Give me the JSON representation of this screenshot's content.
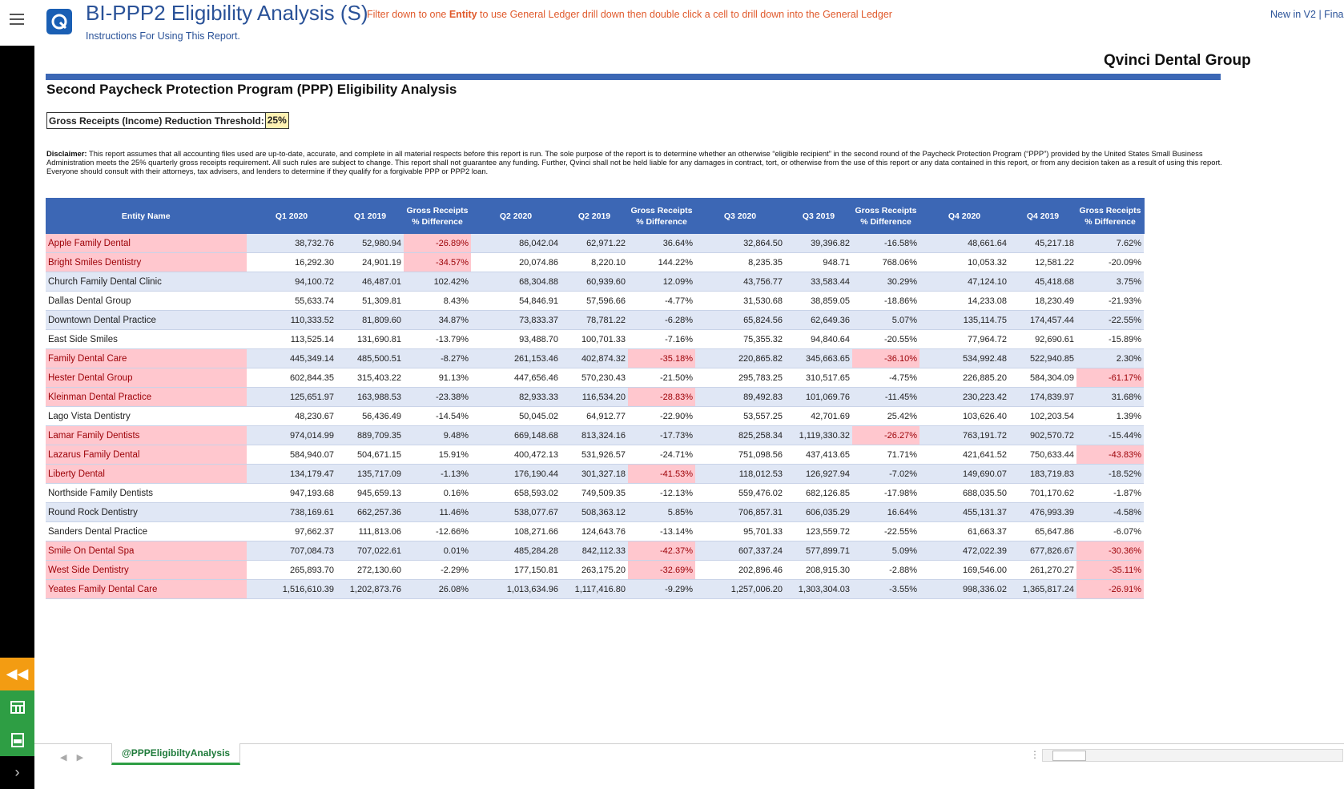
{
  "header": {
    "app_title": "BI-PPP2 Eligibility Analysis (S)",
    "filter_note_prefix": "Filter down to one ",
    "filter_note_bold": "Entity",
    "filter_note_suffix": " to use General Ledger drill down then double click a cell to drill down into the General Ledger",
    "instructions_link": "Instructions For Using This Report.",
    "new_in": "New in V2 | Fina"
  },
  "report": {
    "company": "Qvinci Dental Group",
    "title": "Second Paycheck Protection Program (PPP) Eligibility Analysis",
    "threshold_label": "Gross Receipts (Income) Reduction Threshold:",
    "threshold_value": "25%",
    "disclaimer_label": "Disclaimer:",
    "disclaimer_text": " This report assumes that all accounting files used are up-to-date, accurate, and complete in all material respects before this report is run.  The sole purpose of the report is to determine whether an otherwise “eligible recipient” in the second round of the Paycheck Protection Program (“PPP”) provided by the United States Small Business Administration meets the 25% quarterly gross receipts requirement.  All such rules are subject to change.  This report shall not guarantee any funding.  Further, Qvinci shall not be held liable for any damages in contract, tort, or otherwise from the use of this report or any data contained in this report, or from any decision taken as a result of using this report. Everyone should consult with their attorneys, tax advisers, and lenders to determine if they qualify for a forgivable PPP or PPP2 loan."
  },
  "table": {
    "columns": [
      "Entity Name",
      "Q1 2020",
      "Q1 2019",
      "Gross Receipts % Difference",
      "Q2 2020",
      "Q2 2019",
      "Gross Receipts % Difference",
      "Q3 2020",
      "Q3 2019",
      "Gross Receipts % Difference",
      "Q4 2020",
      "Q4 2019",
      "Gross Receipts % Difference"
    ],
    "rows": [
      [
        "Apple Family Dental",
        "38,732.76",
        "52,980.94",
        "-26.89%",
        "86,042.04",
        "62,971.22",
        "36.64%",
        "32,864.50",
        "39,396.82",
        "-16.58%",
        "48,661.64",
        "45,217.18",
        "7.62%"
      ],
      [
        "Bright Smiles Dentistry",
        "16,292.30",
        "24,901.19",
        "-34.57%",
        "20,074.86",
        "8,220.10",
        "144.22%",
        "8,235.35",
        "948.71",
        "768.06%",
        "10,053.32",
        "12,581.22",
        "-20.09%"
      ],
      [
        "Church Family Dental Clinic",
        "94,100.72",
        "46,487.01",
        "102.42%",
        "68,304.88",
        "60,939.60",
        "12.09%",
        "43,756.77",
        "33,583.44",
        "30.29%",
        "47,124.10",
        "45,418.68",
        "3.75%"
      ],
      [
        "Dallas Dental Group",
        "55,633.74",
        "51,309.81",
        "8.43%",
        "54,846.91",
        "57,596.66",
        "-4.77%",
        "31,530.68",
        "38,859.05",
        "-18.86%",
        "14,233.08",
        "18,230.49",
        "-21.93%"
      ],
      [
        "Downtown Dental Practice",
        "110,333.52",
        "81,809.60",
        "34.87%",
        "73,833.37",
        "78,781.22",
        "-6.28%",
        "65,824.56",
        "62,649.36",
        "5.07%",
        "135,114.75",
        "174,457.44",
        "-22.55%"
      ],
      [
        "East Side Smiles",
        "113,525.14",
        "131,690.81",
        "-13.79%",
        "93,488.70",
        "100,701.33",
        "-7.16%",
        "75,355.32",
        "94,840.64",
        "-20.55%",
        "77,964.72",
        "92,690.61",
        "-15.89%"
      ],
      [
        "Family Dental Care",
        "445,349.14",
        "485,500.51",
        "-8.27%",
        "261,153.46",
        "402,874.32",
        "-35.18%",
        "220,865.82",
        "345,663.65",
        "-36.10%",
        "534,992.48",
        "522,940.85",
        "2.30%"
      ],
      [
        "Hester Dental Group",
        "602,844.35",
        "315,403.22",
        "91.13%",
        "447,656.46",
        "570,230.43",
        "-21.50%",
        "295,783.25",
        "310,517.65",
        "-4.75%",
        "226,885.20",
        "584,304.09",
        "-61.17%"
      ],
      [
        "Kleinman Dental Practice",
        "125,651.97",
        "163,988.53",
        "-23.38%",
        "82,933.33",
        "116,534.20",
        "-28.83%",
        "89,492.83",
        "101,069.76",
        "-11.45%",
        "230,223.42",
        "174,839.97",
        "31.68%"
      ],
      [
        "Lago Vista Dentistry",
        "48,230.67",
        "56,436.49",
        "-14.54%",
        "50,045.02",
        "64,912.77",
        "-22.90%",
        "53,557.25",
        "42,701.69",
        "25.42%",
        "103,626.40",
        "102,203.54",
        "1.39%"
      ],
      [
        "Lamar Family Dentists",
        "974,014.99",
        "889,709.35",
        "9.48%",
        "669,148.68",
        "813,324.16",
        "-17.73%",
        "825,258.34",
        "1,119,330.32",
        "-26.27%",
        "763,191.72",
        "902,570.72",
        "-15.44%"
      ],
      [
        "Lazarus Family Dental",
        "584,940.07",
        "504,671.15",
        "15.91%",
        "400,472.13",
        "531,926.57",
        "-24.71%",
        "751,098.56",
        "437,413.65",
        "71.71%",
        "421,641.52",
        "750,633.44",
        "-43.83%"
      ],
      [
        "Liberty Dental",
        "134,179.47",
        "135,717.09",
        "-1.13%",
        "176,190.44",
        "301,327.18",
        "-41.53%",
        "118,012.53",
        "126,927.94",
        "-7.02%",
        "149,690.07",
        "183,719.83",
        "-18.52%"
      ],
      [
        "Northside Family Dentists",
        "947,193.68",
        "945,659.13",
        "0.16%",
        "658,593.02",
        "749,509.35",
        "-12.13%",
        "559,476.02",
        "682,126.85",
        "-17.98%",
        "688,035.50",
        "701,170.62",
        "-1.87%"
      ],
      [
        "Round Rock Dentistry",
        "738,169.61",
        "662,257.36",
        "11.46%",
        "538,077.67",
        "508,363.12",
        "5.85%",
        "706,857.31",
        "606,035.29",
        "16.64%",
        "455,131.37",
        "476,993.39",
        "-4.58%"
      ],
      [
        "Sanders Dental Practice",
        "97,662.37",
        "111,813.06",
        "-12.66%",
        "108,271.66",
        "124,643.76",
        "-13.14%",
        "95,701.33",
        "123,559.72",
        "-22.55%",
        "61,663.37",
        "65,647.86",
        "-6.07%"
      ],
      [
        "Smile On Dental Spa",
        "707,084.73",
        "707,022.61",
        "0.01%",
        "485,284.28",
        "842,112.33",
        "-42.37%",
        "607,337.24",
        "577,899.71",
        "5.09%",
        "472,022.39",
        "677,826.67",
        "-30.36%"
      ],
      [
        "West Side Dentistry",
        "265,893.70",
        "272,130.60",
        "-2.29%",
        "177,150.81",
        "263,175.20",
        "-32.69%",
        "202,896.46",
        "208,915.30",
        "-2.88%",
        "169,546.00",
        "261,270.27",
        "-35.11%"
      ],
      [
        "Yeates Family Dental Care",
        "1,516,610.39",
        "1,202,873.76",
        "26.08%",
        "1,013,634.96",
        "1,117,416.80",
        "-9.29%",
        "1,257,006.20",
        "1,303,304.03",
        "-3.55%",
        "998,336.02",
        "1,365,817.24",
        "-26.91%"
      ]
    ],
    "highlighted_names": [
      "Apple Family Dental",
      "Bright Smiles Dentistry",
      "Family Dental Care",
      "Hester Dental Group",
      "Kleinman Dental Practice",
      "Lamar Family Dentists",
      "Lazarus Family Dental",
      "Liberty Dental",
      "Smile On Dental Spa",
      "West Side Dentistry",
      "Yeates Family Dental Care"
    ],
    "highlight_color": "#ffc7ce",
    "header_color": "#3c67b5"
  },
  "sheet": {
    "tab_label": "@PPPEligibiltyAnalysis"
  },
  "colors": {
    "title_blue": "#2a5298",
    "note_orange": "#e05a2c",
    "rail_orange": "#f39c12",
    "rail_green": "#2e9e44"
  }
}
